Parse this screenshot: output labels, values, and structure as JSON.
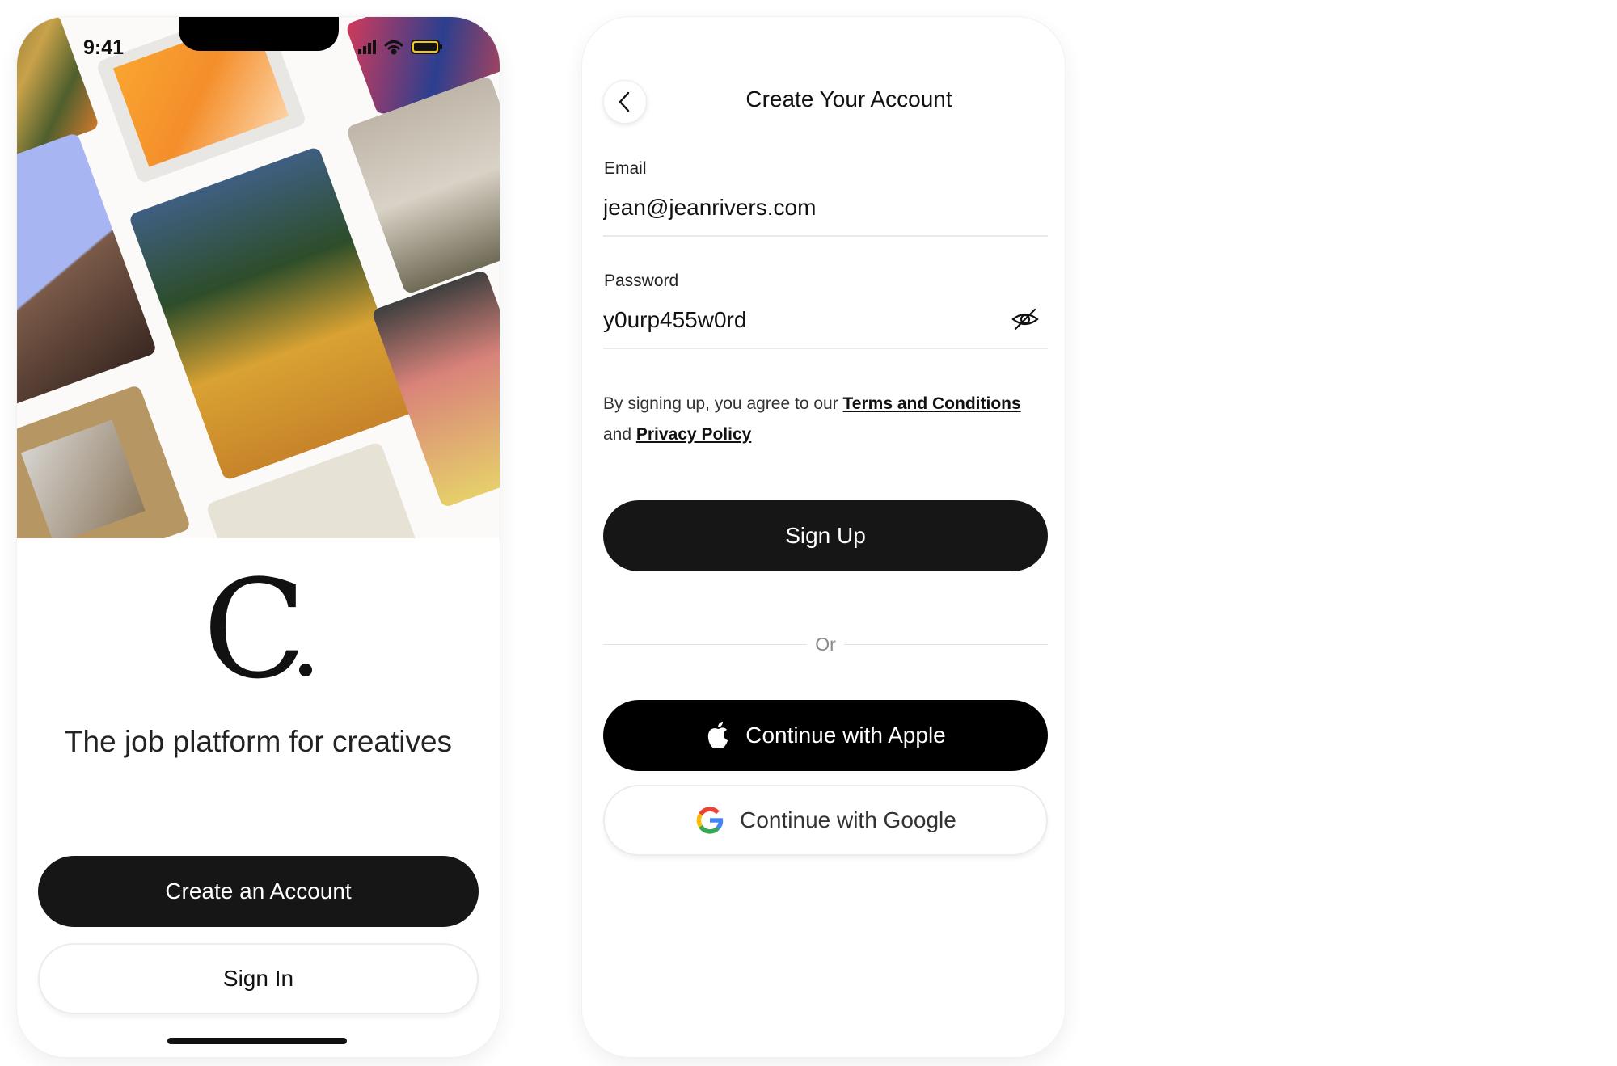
{
  "welcome_screen": {
    "status_time": "9:41",
    "logo_letter": "C",
    "tagline": "The job platform for creatives",
    "create_account_label": "Create an Account",
    "sign_in_label": "Sign In"
  },
  "signup_screen": {
    "title": "Create Your Account",
    "email_label": "Email",
    "email_value": "jean@jeanrivers.com",
    "password_label": "Password",
    "password_value": "y0urp455w0rd",
    "terms_prefix": "By signing up, you agree to our ",
    "terms_link": "Terms and Conditions",
    "terms_middle": "and ",
    "privacy_link": "Privacy Policy",
    "sign_up_label": "Sign Up",
    "or_label": "Or",
    "apple_label": "Continue with Apple",
    "google_label": "Continue with Google"
  },
  "icons": {
    "back": "chevron-left-icon",
    "password_toggle": "eye-off-icon",
    "apple": "apple-logo-icon",
    "google": "google-logo-icon"
  },
  "colors": {
    "button_dark": "#161616",
    "text_primary": "#111111",
    "divider": "#e9e9e9",
    "google_blue": "#4285F4",
    "google_red": "#EA4335",
    "google_yellow": "#FBBC05",
    "google_green": "#34A853"
  }
}
